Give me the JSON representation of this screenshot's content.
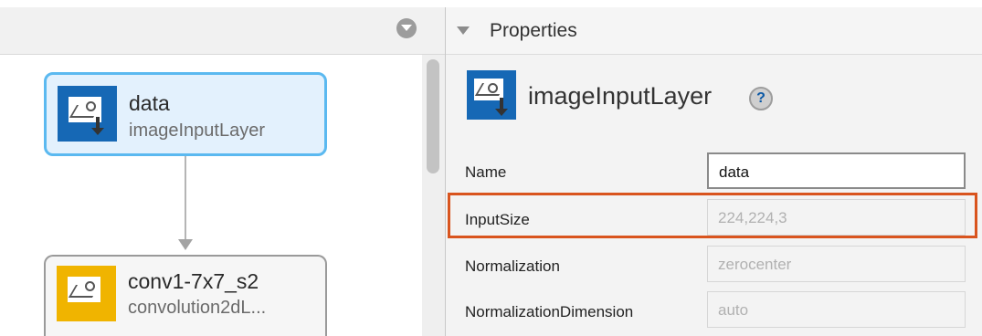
{
  "canvas": {
    "nodes": [
      {
        "name": "data",
        "type": "imageInputLayer",
        "selected": true,
        "icon": "image-input-icon",
        "color": "#1668b5"
      },
      {
        "name": "conv1-7x7_s2",
        "type": "convolution2dL...",
        "selected": false,
        "icon": "convolution-icon",
        "color": "#f0b400"
      }
    ],
    "collapse_icon": "chevron-down-circle-icon"
  },
  "properties": {
    "header": "Properties",
    "selected_layer_type": "imageInputLayer",
    "help_label": "?",
    "rows": [
      {
        "label": "Name",
        "value": "data",
        "editable": true
      },
      {
        "label": "InputSize",
        "value": "224,224,3",
        "editable": false,
        "highlighted": true
      },
      {
        "label": "Normalization",
        "value": "zerocenter",
        "editable": false
      },
      {
        "label": "NormalizationDimension",
        "value": "auto",
        "editable": false
      }
    ]
  },
  "colors": {
    "selected_border": "#5bb9f0",
    "highlight_box": "#d9541e"
  }
}
